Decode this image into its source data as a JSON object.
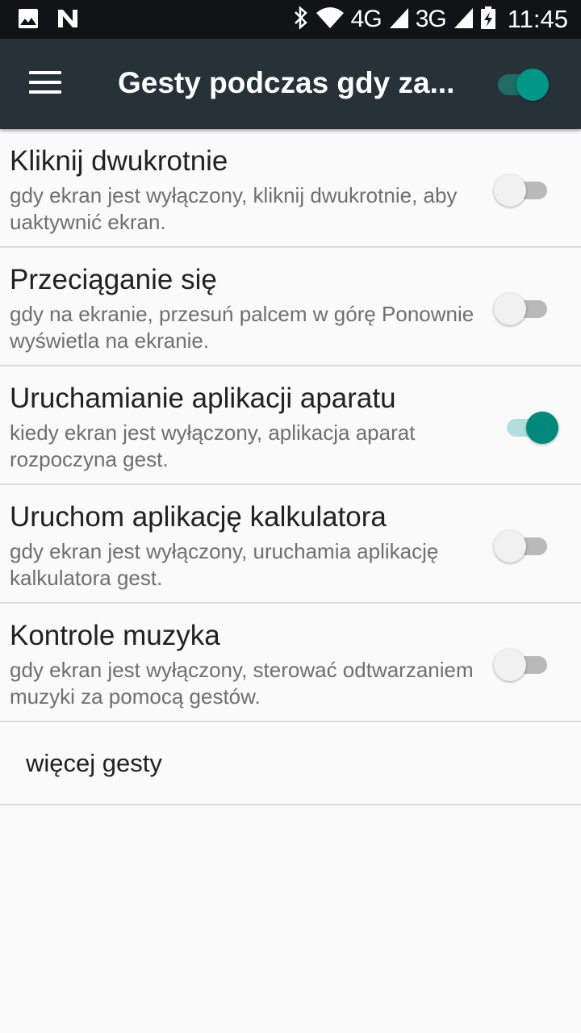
{
  "status_bar": {
    "network_4g": "4G",
    "network_3g": "3G",
    "time": "11:45"
  },
  "app_bar": {
    "title": "Gesty podczas gdy za...",
    "master_switch_on": true
  },
  "settings": [
    {
      "title": "Kliknij dwukrotnie",
      "subtitle": "gdy ekran jest wyłączony, kliknij dwukrotnie, aby uaktywnić ekran.",
      "enabled": false
    },
    {
      "title": "Przeciąganie się",
      "subtitle": "gdy na ekranie, przesuń palcem w górę Ponownie wyświetla na ekranie.",
      "enabled": false
    },
    {
      "title": "Uruchamianie aplikacji aparatu",
      "subtitle": "kiedy ekran jest wyłączony, aplikacja aparat rozpoczyna gest.",
      "enabled": true
    },
    {
      "title": "Uruchom aplikację kalkulatora",
      "subtitle": "gdy ekran jest wyłączony, uruchamia aplikację kalkulatora gest.",
      "enabled": false
    },
    {
      "title": "Kontrole muzyka",
      "subtitle": "gdy ekran jest wyłączony, sterować odtwarzaniem muzyki za pomocą gestów.",
      "enabled": false
    }
  ],
  "more": {
    "label": "więcej gesty"
  },
  "colors": {
    "accent": "#009688",
    "appbar": "#263238",
    "statusbar": "#111316"
  }
}
